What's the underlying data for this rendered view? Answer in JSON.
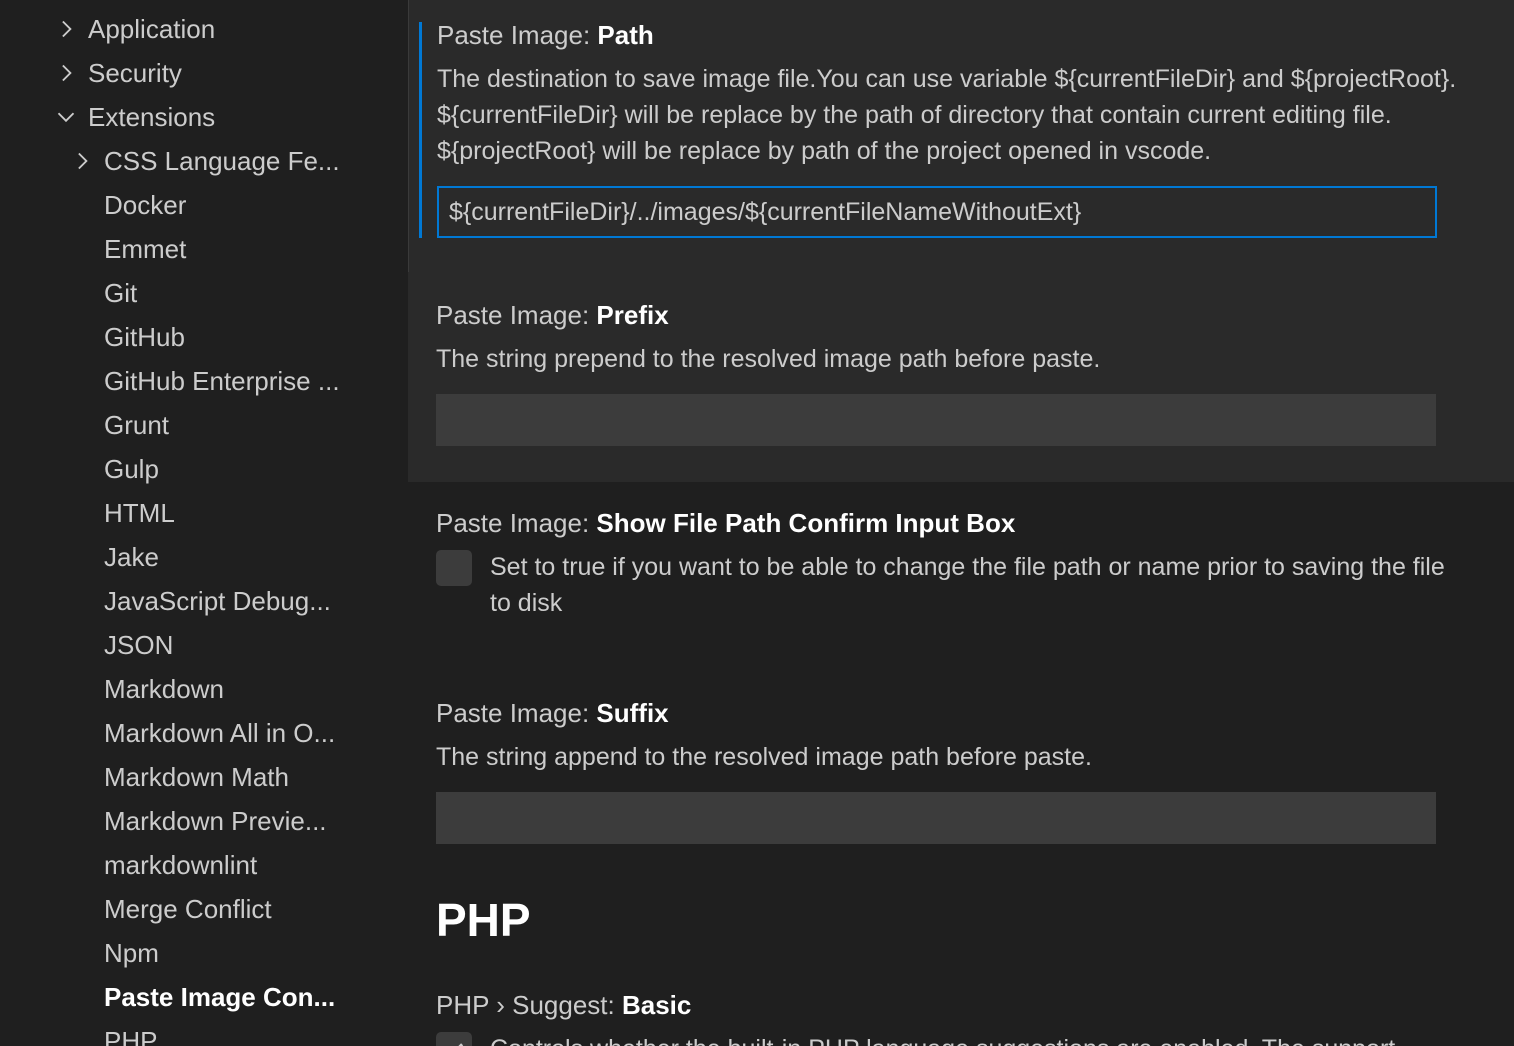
{
  "sidebar": {
    "items": [
      {
        "label": "Application",
        "state": "collapsed"
      },
      {
        "label": "Security",
        "state": "collapsed"
      },
      {
        "label": "Extensions",
        "state": "expanded"
      },
      {
        "label": "CSS Language Fe...",
        "state": "collapsed"
      },
      {
        "label": "Docker",
        "state": "leaf"
      },
      {
        "label": "Emmet",
        "state": "leaf"
      },
      {
        "label": "Git",
        "state": "leaf"
      },
      {
        "label": "GitHub",
        "state": "leaf"
      },
      {
        "label": "GitHub Enterprise ...",
        "state": "leaf"
      },
      {
        "label": "Grunt",
        "state": "leaf"
      },
      {
        "label": "Gulp",
        "state": "leaf"
      },
      {
        "label": "HTML",
        "state": "leaf"
      },
      {
        "label": "Jake",
        "state": "leaf"
      },
      {
        "label": "JavaScript Debug...",
        "state": "leaf"
      },
      {
        "label": "JSON",
        "state": "leaf"
      },
      {
        "label": "Markdown",
        "state": "leaf"
      },
      {
        "label": "Markdown All in O...",
        "state": "leaf"
      },
      {
        "label": "Markdown Math",
        "state": "leaf"
      },
      {
        "label": "Markdown Previe...",
        "state": "leaf"
      },
      {
        "label": "markdownlint",
        "state": "leaf"
      },
      {
        "label": "Merge Conflict",
        "state": "leaf"
      },
      {
        "label": "Npm",
        "state": "leaf"
      },
      {
        "label": "Paste Image Con...",
        "state": "selected"
      },
      {
        "label": "PHP",
        "state": "leaf"
      }
    ]
  },
  "settings": {
    "path": {
      "category": "Paste Image: ",
      "name": "Path",
      "desc_line1": "The destination to save image file.You can use variable ${currentFileDir} and ${projectRoot}.",
      "desc_line2": "${currentFileDir} will be replace by the path of directory that contain current editing file.",
      "desc_line3": "${projectRoot} will be replace by path of the project opened in vscode.",
      "value": "${currentFileDir}/../images/${currentFileNameWithoutExt}"
    },
    "prefix": {
      "category": "Paste Image: ",
      "name": "Prefix",
      "desc": "The string prepend to the resolved image path before paste.",
      "value": ""
    },
    "confirm": {
      "category": "Paste Image: ",
      "name": "Show File Path Confirm Input Box",
      "desc_line1": "Set to true if you want to be able to change the file path or name prior to saving the file",
      "desc_line2": "to disk",
      "checked": false
    },
    "suffix": {
      "category": "Paste Image: ",
      "name": "Suffix",
      "desc": "The string append to the resolved image path before paste.",
      "value": ""
    },
    "php_section": "PHP",
    "php_basic": {
      "category": "PHP › Suggest: ",
      "name": "Basic",
      "desc": "Controls whether the built-in PHP language suggestions are enabled. The support",
      "checked": true
    }
  }
}
